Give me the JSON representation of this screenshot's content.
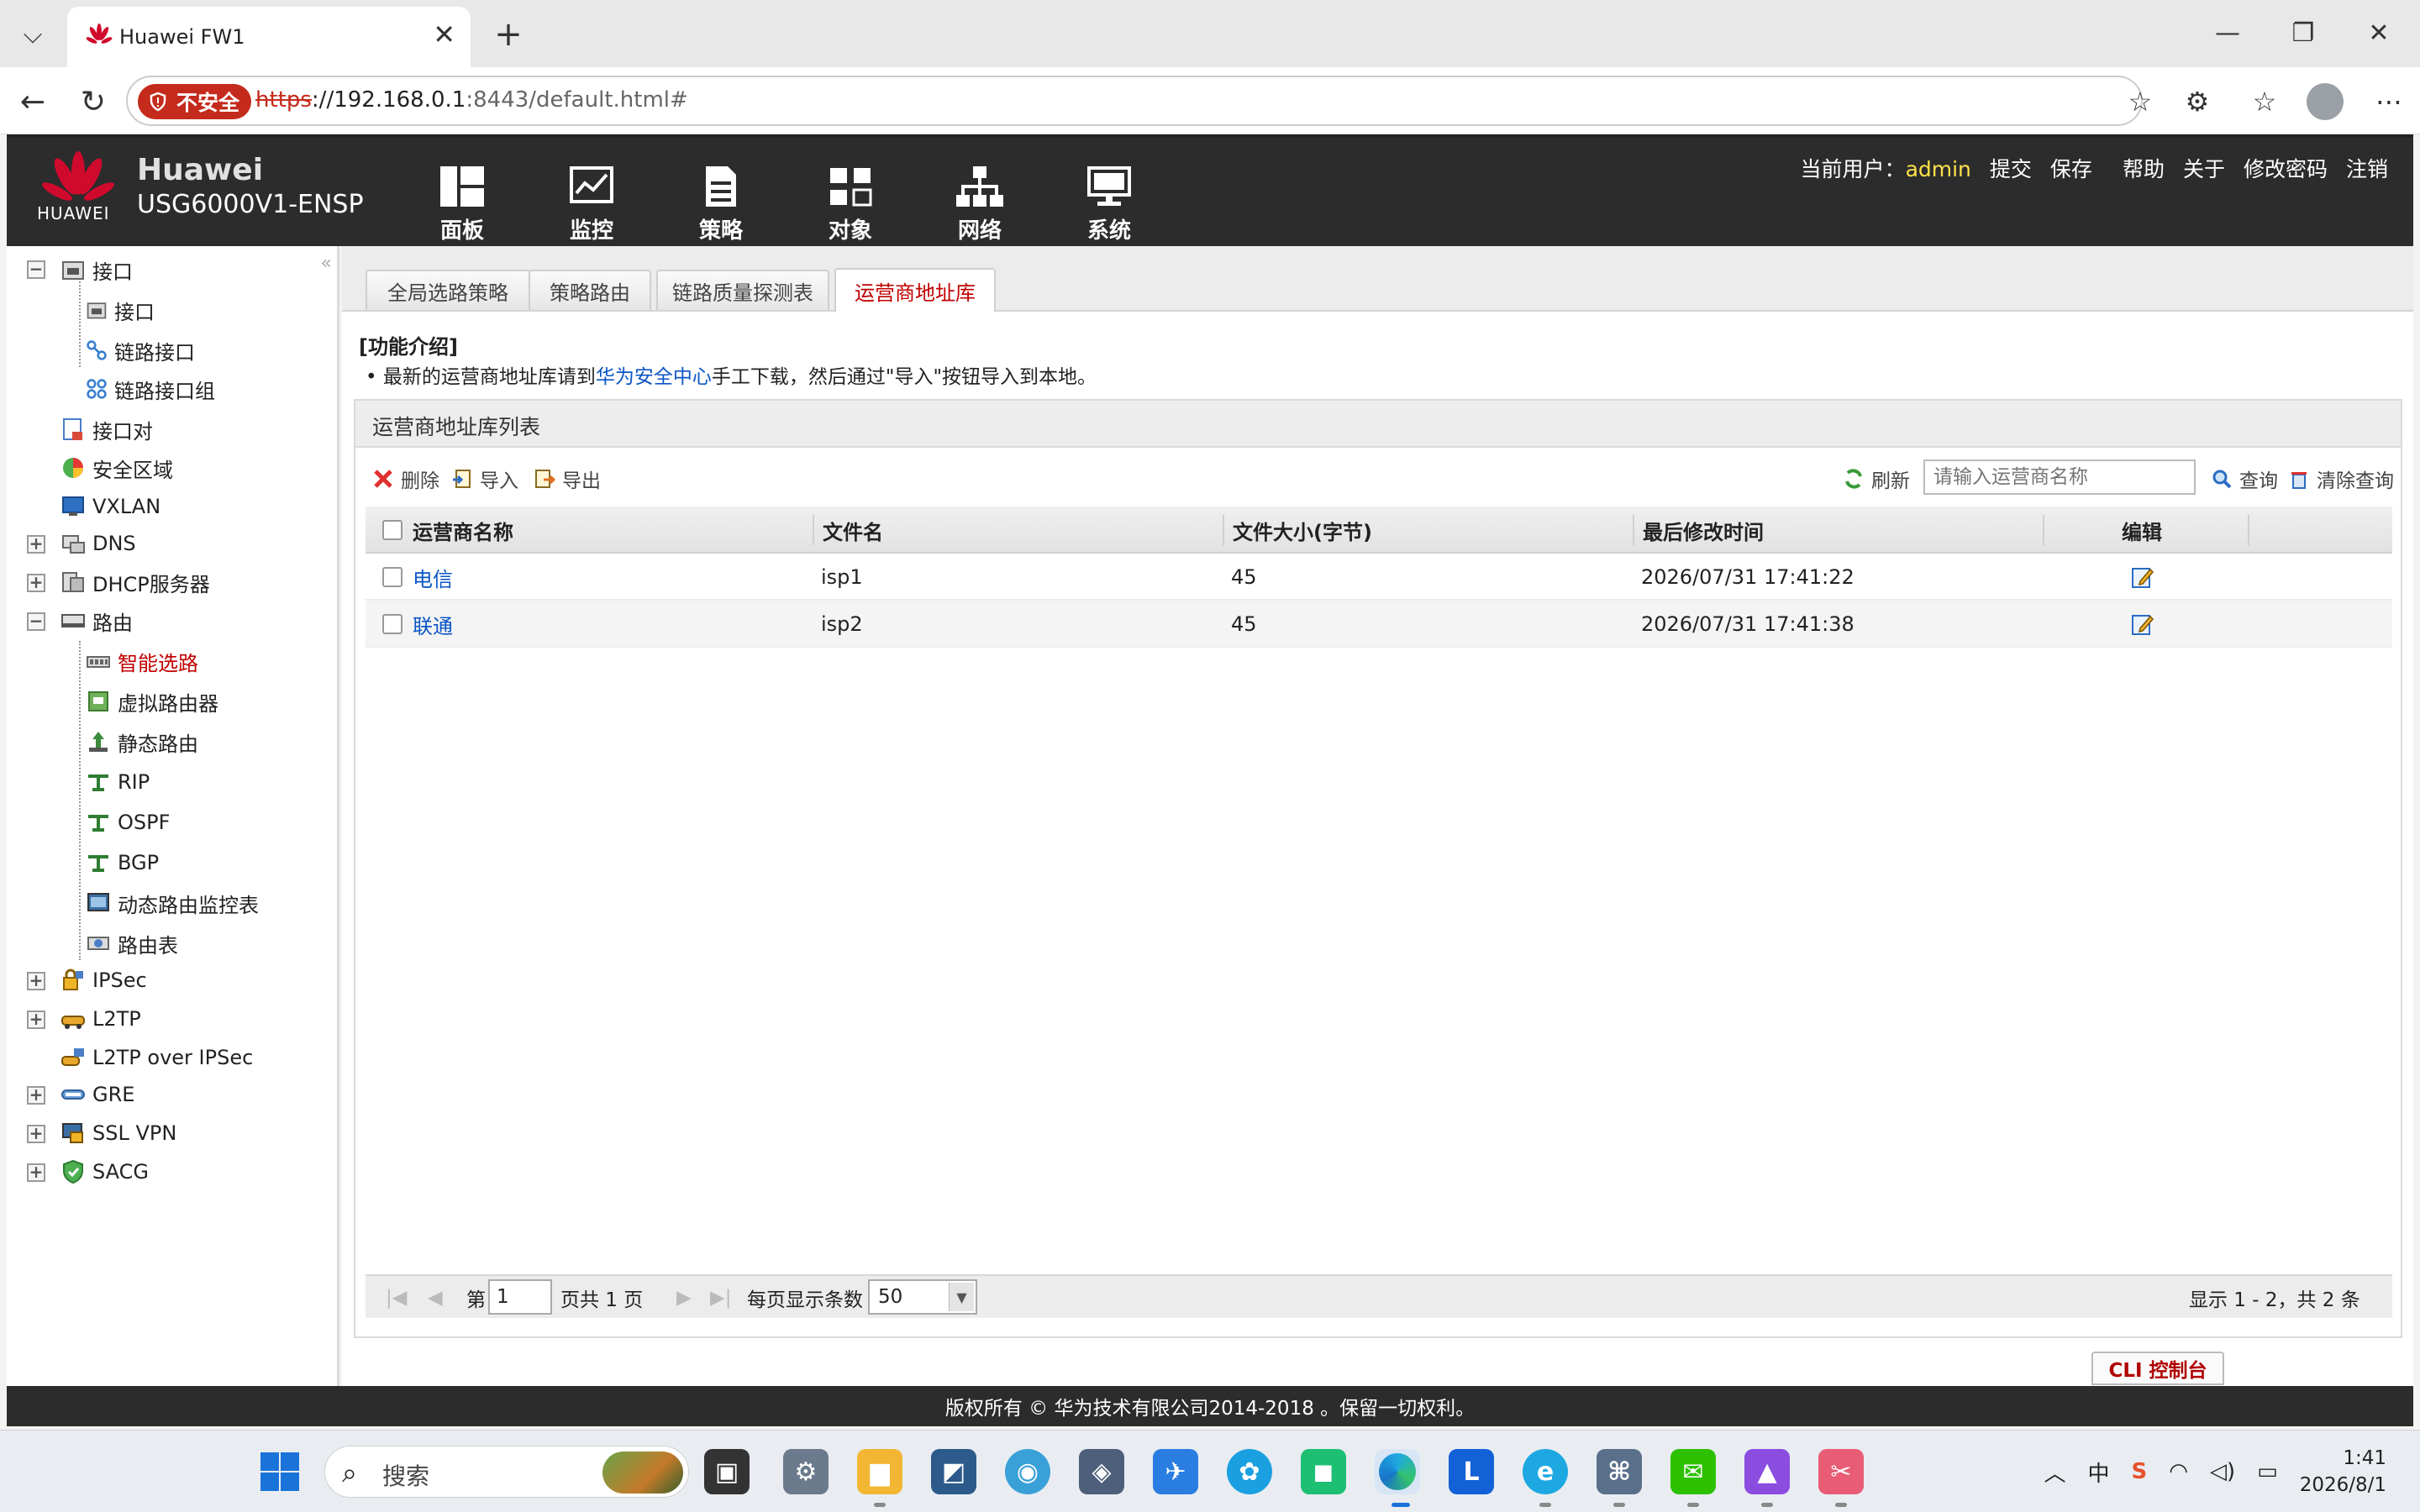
{
  "browser": {
    "tab_title": "Huawei FW1",
    "security_label": "不安全",
    "url_scheme": "https",
    "url_host": "://192.168.0.1",
    "url_rest": ":8443/default.html#"
  },
  "app": {
    "brand": "Huawei",
    "logo_text": "HUAWEI",
    "model": "USG6000V1-ENSP",
    "nav": [
      "面板",
      "监控",
      "策略",
      "对象",
      "网络",
      "系统"
    ],
    "user_label": "当前用户：",
    "user_name": "admin",
    "actions": [
      "提交",
      "保存",
      "帮助",
      "关于",
      "修改密码",
      "注销"
    ],
    "footer": "版权所有 © 华为技术有限公司2014-2018 。保留一切权利。"
  },
  "sidebar": {
    "items": [
      {
        "label": "接口"
      },
      {
        "label": "接口"
      },
      {
        "label": "链路接口"
      },
      {
        "label": "链路接口组"
      },
      {
        "label": "接口对"
      },
      {
        "label": "安全区域"
      },
      {
        "label": "VXLAN"
      },
      {
        "label": "DNS"
      },
      {
        "label": "DHCP服务器"
      },
      {
        "label": "路由"
      },
      {
        "label": "智能选路"
      },
      {
        "label": "虚拟路由器"
      },
      {
        "label": "静态路由"
      },
      {
        "label": "RIP"
      },
      {
        "label": "OSPF"
      },
      {
        "label": "BGP"
      },
      {
        "label": "动态路由监控表"
      },
      {
        "label": "路由表"
      },
      {
        "label": "IPSec"
      },
      {
        "label": "L2TP"
      },
      {
        "label": "L2TP over IPSec"
      },
      {
        "label": "GRE"
      },
      {
        "label": "SSL VPN"
      },
      {
        "label": "SACG"
      }
    ]
  },
  "subtabs": [
    "全局选路策略",
    "策略路由",
    "链路质量探测表",
    "运营商地址库"
  ],
  "intro": {
    "title": "[功能介绍]",
    "bullet": "•",
    "before": "最新的运营商地址库请到",
    "link": "华为安全中心",
    "after": "手工下载，然后通过\"导入\"按钮导入到本地。"
  },
  "panel": {
    "title": "运营商地址库列表",
    "toolbar": {
      "delete": "删除",
      "import": "导入",
      "export": "导出",
      "refresh": "刷新",
      "search_placeholder": "请输入运营商名称",
      "query": "查询",
      "clear_query": "清除查询"
    },
    "columns": [
      "运营商名称",
      "文件名",
      "文件大小(字节)",
      "最后修改时间",
      "编辑"
    ],
    "rows": [
      {
        "name": "电信",
        "file": "isp1",
        "size": "45",
        "modified": "2026/07/31 17:41:22"
      },
      {
        "name": "联通",
        "file": "isp2",
        "size": "45",
        "modified": "2026/07/31 17:41:38"
      }
    ],
    "pager": {
      "page_prefix": "第",
      "page_value": "1",
      "page_suffix": "页共 1 页",
      "per_page_label": "每页显示条数",
      "per_page_value": "50",
      "summary": "显示 1 - 2，共 2 条"
    }
  },
  "cli_button": "CLI 控制台",
  "taskbar": {
    "search_text": "搜索",
    "ime": "中",
    "time": "1:41",
    "date": "2026/8/1"
  },
  "colors": {
    "brand_red": "#cf0a2c",
    "link": "#0a55c5",
    "header_bg": "#2c2c2c",
    "selected": "#c00000"
  }
}
